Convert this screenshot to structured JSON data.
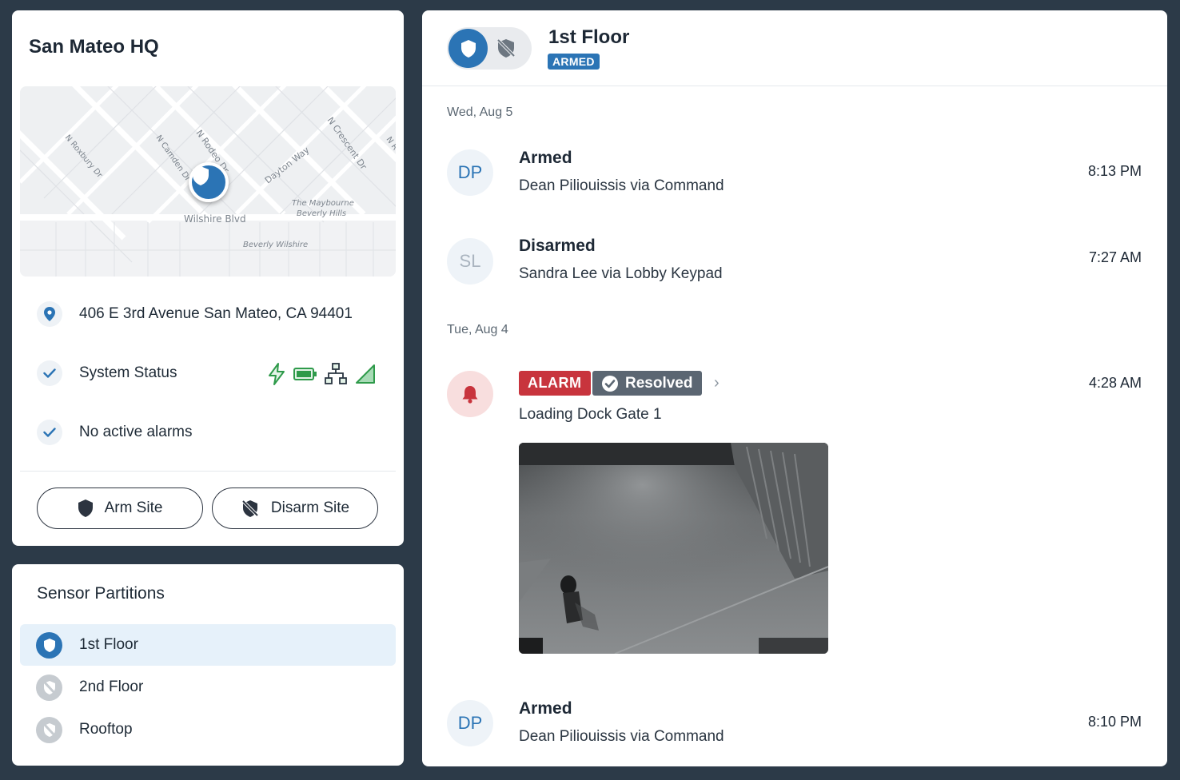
{
  "site": {
    "title": "San Mateo HQ",
    "address": "406 E 3rd Avenue San Mateo, CA 94401",
    "system_status_label": "System Status",
    "alarms_label": "No active alarms",
    "arm_button": "Arm Site",
    "disarm_button": "Disarm Site",
    "status_icons": [
      "power-icon",
      "battery-icon",
      "network-icon",
      "signal-icon"
    ],
    "map_labels": {
      "roxbury": "N Roxbury Dr",
      "camden": "N Camden Dr",
      "rodeo": "N Rodeo Dr",
      "crescent": "N Crescent Dr",
      "nr": "N R",
      "dayton": "Dayton Way",
      "wilshire": "Wilshire Blvd",
      "maybourne1": "The Maybourne",
      "maybourne2": "Beverly Hills",
      "beverly_wilshire": "Beverly Wilshire"
    }
  },
  "partitions": {
    "title": "Sensor Partitions",
    "items": [
      {
        "label": "1st Floor",
        "armed": true
      },
      {
        "label": "2nd Floor",
        "armed": false
      },
      {
        "label": "Rooftop",
        "armed": false
      }
    ]
  },
  "feed": {
    "title": "1st Floor",
    "status_badge": "ARMED",
    "groups": [
      {
        "date": "Wed, Aug 5",
        "events": [
          {
            "initials": "DP",
            "title": "Armed",
            "detail": "Dean Piliouissis via Command",
            "time": "8:13 PM"
          },
          {
            "initials": "SL",
            "title": "Disarmed",
            "detail": "Sandra Lee via Lobby Keypad",
            "time": "7:27 AM"
          }
        ]
      },
      {
        "date": "Tue, Aug 4",
        "events": [
          {
            "alarm_badge": "ALARM",
            "resolved_badge": "Resolved",
            "detail": "Loading Dock Gate 1",
            "time": "4:28 AM"
          },
          {
            "initials": "DP",
            "title": "Armed",
            "detail": "Dean Piliouissis via Command",
            "time": "8:10 PM"
          }
        ]
      }
    ]
  },
  "colors": {
    "background": "#2c3a48",
    "accent": "#2b74b5",
    "alarm": "#c8343d",
    "resolved": "#5b6672",
    "status_green": "#2e9a4a"
  }
}
